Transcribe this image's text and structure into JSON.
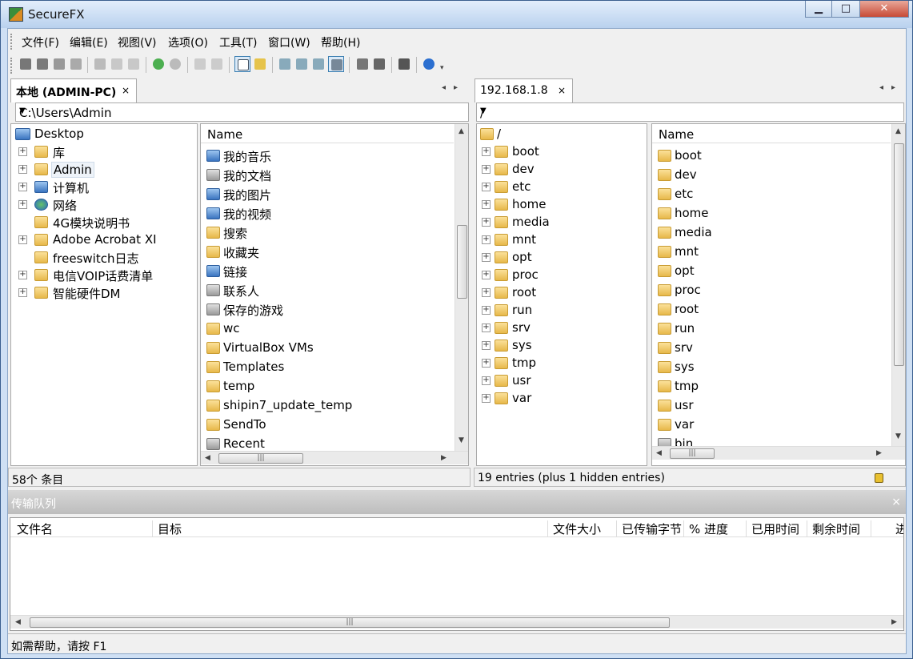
{
  "window": {
    "title": "SecureFX",
    "minimize": "▁",
    "maximize": "□",
    "close": "✕"
  },
  "menu": [
    "文件(F)",
    "编辑(E)",
    "视图(V)",
    "选项(O)",
    "工具(T)",
    "窗口(W)",
    "帮助(H)"
  ],
  "toolbar": {
    "buttons": [
      "connect-icon",
      "quick-connect-icon",
      "connect-tab-icon",
      "disconnect-icon",
      "cut-icon",
      "copy-icon",
      "paste-icon",
      "refresh-icon",
      "stop-icon",
      "delete-icon",
      "properties-icon",
      "local-pane-icon",
      "upload-icon",
      "large-icons-icon",
      "small-icons-icon",
      "list-icon",
      "details-icon",
      "session-options-icon",
      "global-options-icon",
      "keymap-icon",
      "help-icon"
    ]
  },
  "local": {
    "tab_label": "本地 (ADMIN-PC)",
    "tab_close": "×",
    "path": "C:\\Users\\Admin",
    "tree": [
      {
        "label": "Desktop",
        "expandable": false,
        "icon": "desktop-icon"
      },
      {
        "label": "库",
        "expandable": true,
        "icon": "library-icon"
      },
      {
        "label": "Admin",
        "expandable": true,
        "icon": "user-folder-icon"
      },
      {
        "label": "计算机",
        "expandable": true,
        "icon": "computer-icon"
      },
      {
        "label": "网络",
        "expandable": true,
        "icon": "network-icon"
      },
      {
        "label": "4G模块说明书",
        "expandable": false,
        "icon": "folder-icon"
      },
      {
        "label": "Adobe Acrobat XI",
        "expandable": true,
        "icon": "folder-icon"
      },
      {
        "label": "freeswitch日志",
        "expandable": false,
        "icon": "folder-icon"
      },
      {
        "label": "电信VOIP话费清单",
        "expandable": true,
        "icon": "folder-icon"
      },
      {
        "label": "智能硬件DM",
        "expandable": true,
        "icon": "folder-icon"
      }
    ],
    "list_header": "Name",
    "files": [
      "我的音乐",
      "我的文档",
      "我的图片",
      "我的视频",
      "搜索",
      "收藏夹",
      "链接",
      "联系人",
      "保存的游戏",
      "wc",
      "VirtualBox VMs",
      "Templates",
      "temp",
      "shipin7_update_temp",
      "SendTo",
      "Recent"
    ],
    "status": "58个 条目"
  },
  "remote": {
    "tab_label": "192.168.1.8",
    "tab_close": "×",
    "path": "/",
    "tree_root": "/",
    "tree": [
      "boot",
      "dev",
      "etc",
      "home",
      "media",
      "mnt",
      "opt",
      "proc",
      "root",
      "run",
      "srv",
      "sys",
      "tmp",
      "usr",
      "var"
    ],
    "list_header": "Name",
    "files": [
      "boot",
      "dev",
      "etc",
      "home",
      "media",
      "mnt",
      "opt",
      "proc",
      "root",
      "run",
      "srv",
      "sys",
      "tmp",
      "usr",
      "var",
      "bin"
    ],
    "status": "19 entries (plus 1 hidden entries)"
  },
  "queue": {
    "title": "传输队列",
    "close": "×",
    "columns": [
      "文件名",
      "目标",
      "文件大小",
      "已传输字节",
      "% 进度",
      "已用时间",
      "剩余时间",
      "进"
    ]
  },
  "statusbar": "如需帮助，请按 F1"
}
